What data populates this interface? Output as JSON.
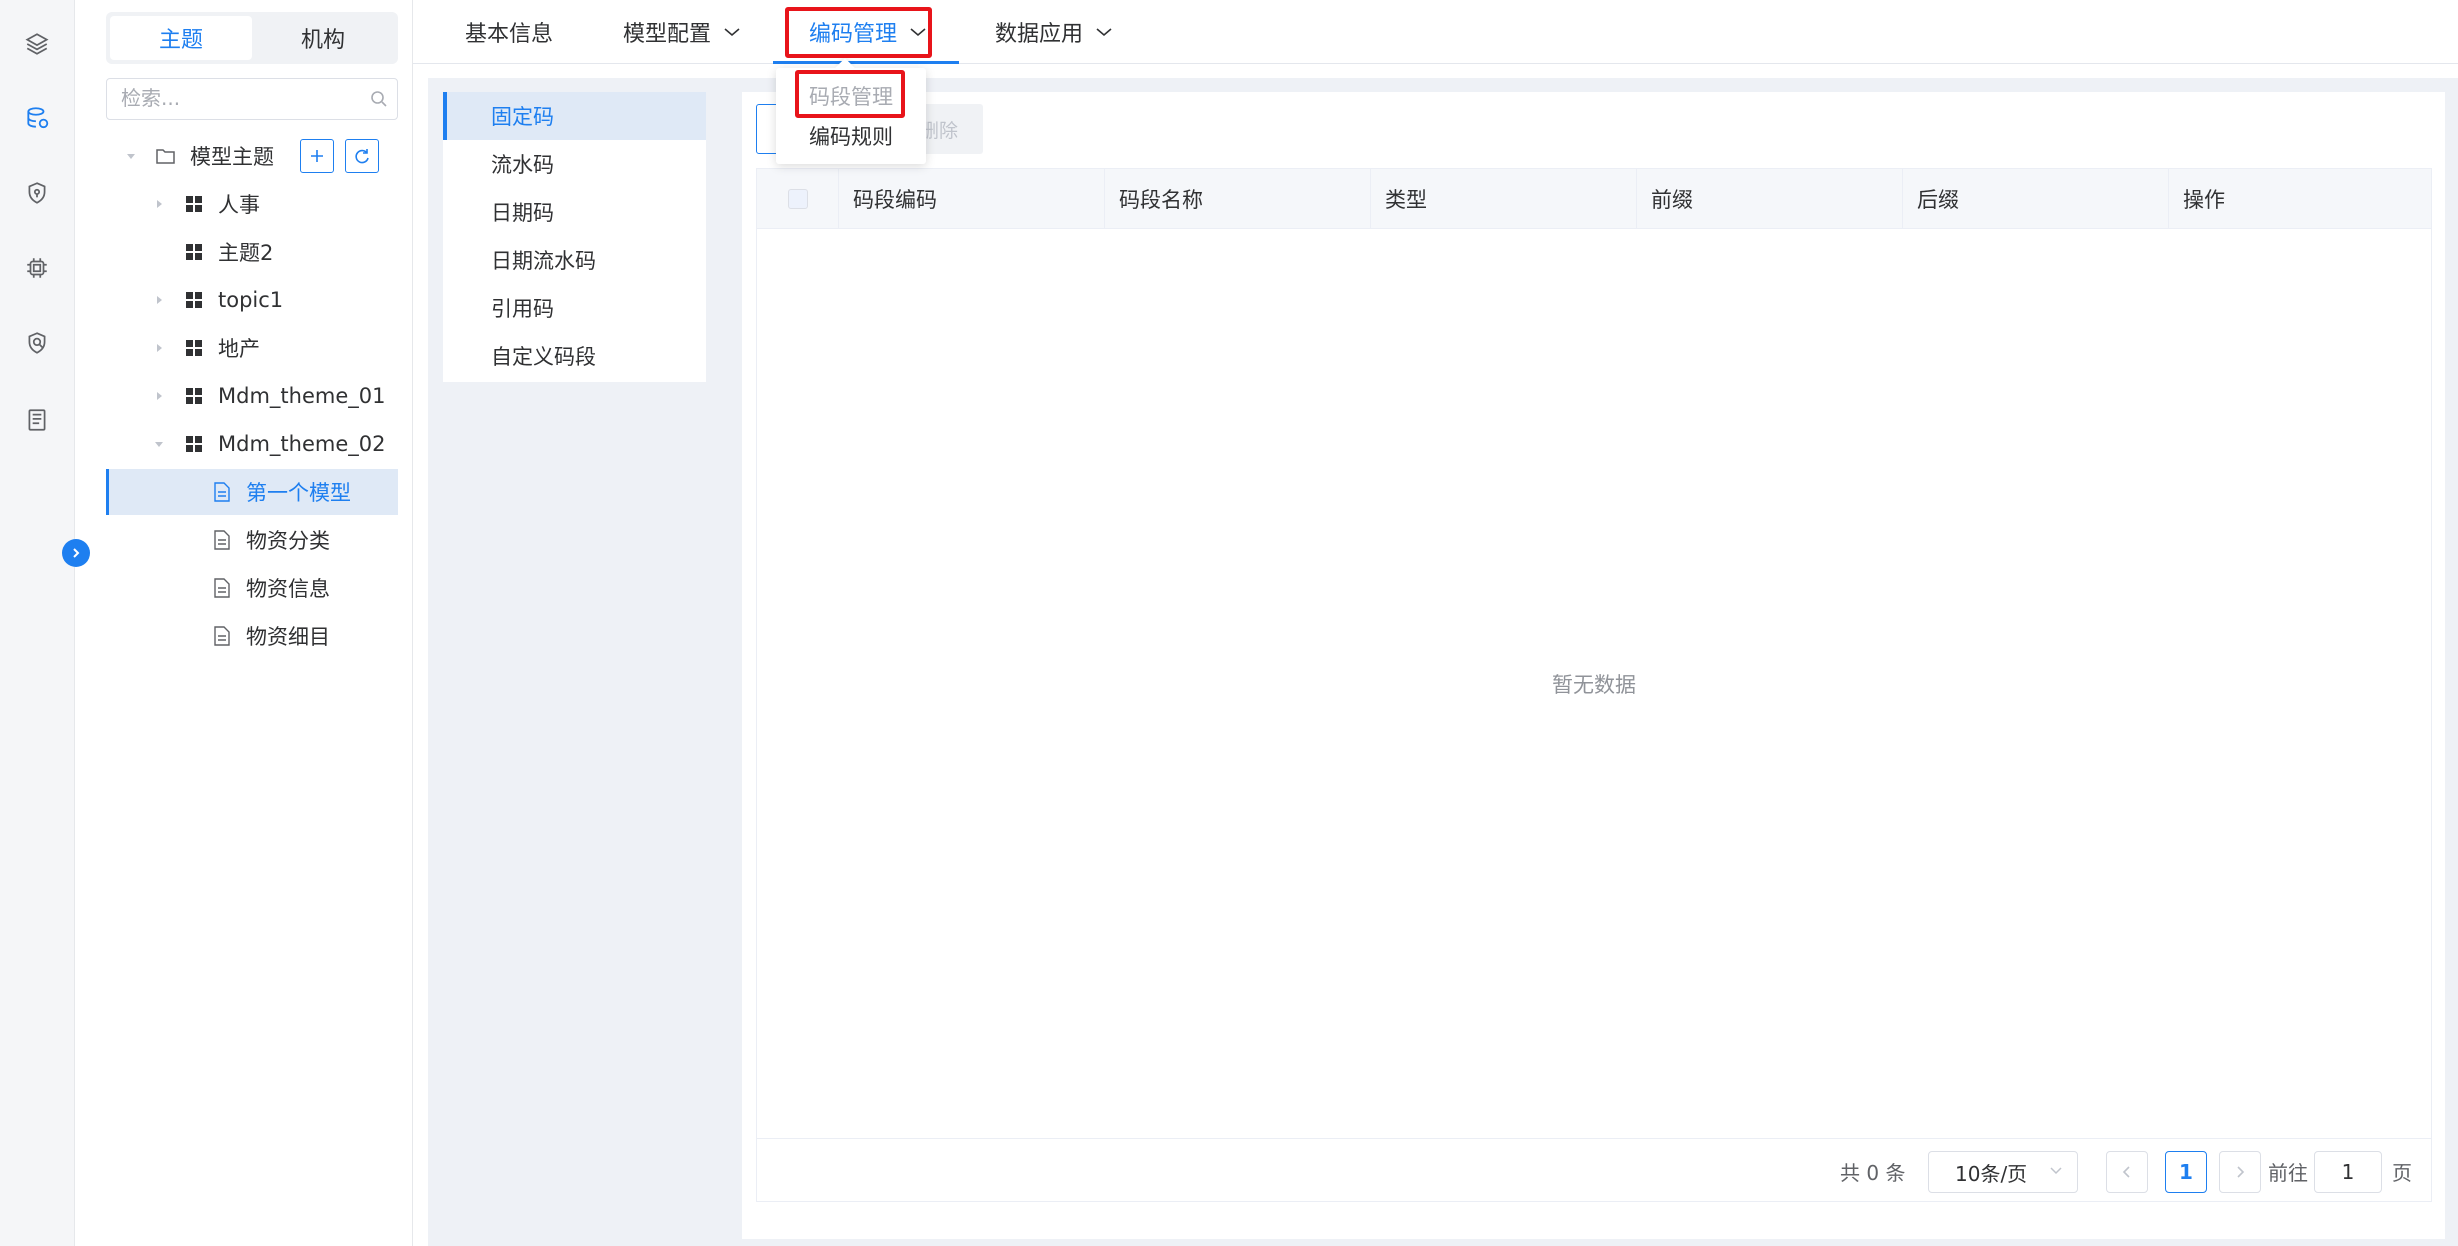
{
  "rail": {
    "icons": [
      "layers-icon",
      "database-icon",
      "shield-icon",
      "chip-icon",
      "security-target-icon",
      "document-list-icon"
    ],
    "active_color": "#1e7ff0"
  },
  "tree_panel": {
    "segment": {
      "topic": "主题",
      "org": "机构"
    },
    "search": {
      "placeholder": "检索..."
    },
    "root": {
      "label": "模型主题"
    },
    "nodes": [
      {
        "label": "人事",
        "type": "grid",
        "expandable": true
      },
      {
        "label": "主题2",
        "type": "grid",
        "expandable": false
      },
      {
        "label": "topic1",
        "type": "grid",
        "expandable": true
      },
      {
        "label": "地产",
        "type": "grid",
        "expandable": true
      },
      {
        "label": "Mdm_theme_01",
        "type": "grid",
        "expandable": true
      },
      {
        "label": "Mdm_theme_02",
        "type": "grid",
        "expandable": true,
        "expanded": true
      }
    ],
    "children": [
      {
        "label": "第一个模型",
        "selected": true
      },
      {
        "label": "物资分类"
      },
      {
        "label": "物资信息"
      },
      {
        "label": "物资细目"
      }
    ]
  },
  "topbar": {
    "tabs": [
      {
        "label": "基本信息"
      },
      {
        "label": "模型配置"
      },
      {
        "label": "编码管理",
        "active": true
      },
      {
        "label": "数据应用"
      }
    ]
  },
  "dropdown": {
    "items": [
      {
        "label": "码段管理",
        "disabled": true
      },
      {
        "label": "编码规则"
      }
    ]
  },
  "subnav": {
    "items": [
      "固定码",
      "流水码",
      "日期码",
      "日期流水码",
      "引用码",
      "自定义码段"
    ]
  },
  "toolbar": {
    "delete_label": "删除"
  },
  "table": {
    "columns": [
      "码段编码",
      "码段名称",
      "类型",
      "前缀",
      "后缀",
      "操作"
    ],
    "empty_text": "暂无数据"
  },
  "pagination": {
    "total": "共 0 条",
    "page_size": "10条/页",
    "current_page": "1",
    "goto_label": "前往",
    "goto_value": "1",
    "page_unit": "页"
  },
  "colors": {
    "primary": "#1e7ff0",
    "highlight": "#e8141a"
  }
}
